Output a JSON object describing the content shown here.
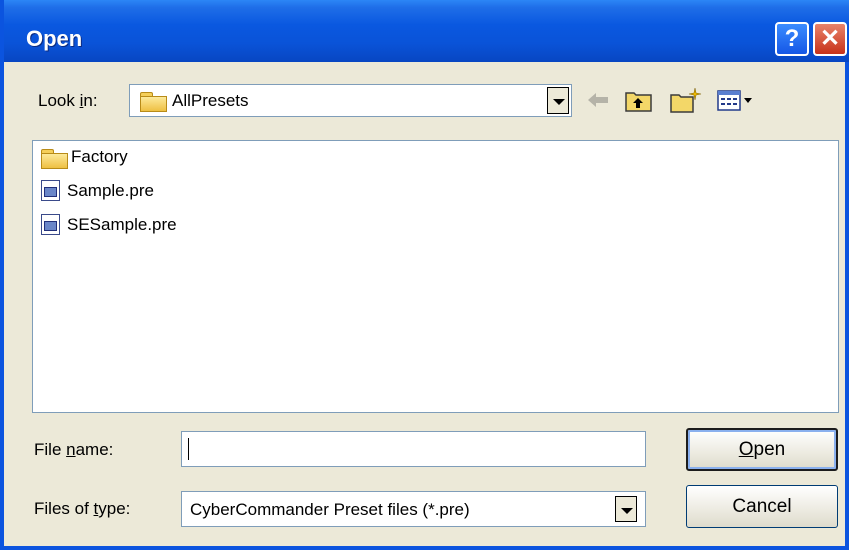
{
  "window": {
    "title": "Open",
    "help_glyph": "?",
    "close_glyph": "✕"
  },
  "lookin": {
    "label_pre": "Look ",
    "label_u": "i",
    "label_post": "n:",
    "value": "AllPresets"
  },
  "toolbar": {
    "back_icon": "back-arrow-icon",
    "up_icon": "up-one-level-icon",
    "newfolder_icon": "new-folder-icon",
    "views_icon": "view-menu-icon"
  },
  "files": [
    {
      "name": "Factory",
      "type": "folder"
    },
    {
      "name": "Sample.pre",
      "type": "file"
    },
    {
      "name": "SESample.pre",
      "type": "file"
    }
  ],
  "filename": {
    "label_pre": "File ",
    "label_u": "n",
    "label_post": "ame:",
    "value": ""
  },
  "filetype": {
    "label_pre": "Files of ",
    "label_u": "t",
    "label_post": "ype:",
    "value": "CyberCommander Preset files (*.pre)"
  },
  "buttons": {
    "open_u": "O",
    "open_rest": "pen",
    "cancel": "Cancel"
  }
}
